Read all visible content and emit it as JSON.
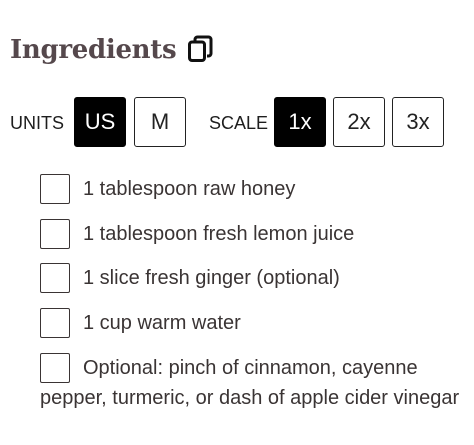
{
  "recipe": {
    "ingredients_title": "Ingredients"
  },
  "units": {
    "label": "UNITS",
    "options": [
      "US",
      "M"
    ],
    "selected": "US"
  },
  "scale": {
    "label": "SCALE",
    "options": [
      "1x",
      "2x",
      "3x"
    ],
    "selected": "1x"
  },
  "ingredients": [
    {
      "text": "1 tablespoon raw honey",
      "checked": false
    },
    {
      "text": "1 tablespoon fresh lemon juice",
      "checked": false
    },
    {
      "text": "1 slice fresh ginger (optional)",
      "checked": false
    },
    {
      "text": "1 cup warm water",
      "checked": false
    },
    {
      "text": "Optional: pinch of cinnamon, cayenne pepper, turmeric, or dash of apple cider vinegar",
      "checked": false
    }
  ],
  "icons": {
    "copy": "copy-icon"
  }
}
